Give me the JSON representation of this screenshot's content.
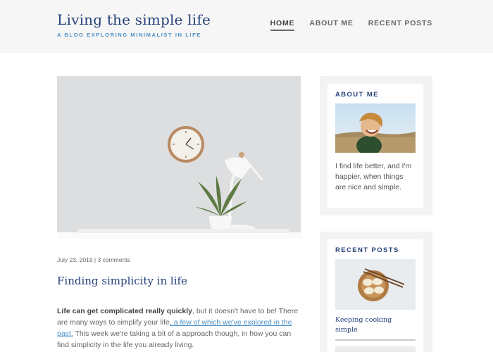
{
  "header": {
    "site_title": "Living the simple life",
    "tagline": "A BLOG EXPLORING MINIMALIST IN LIFE",
    "nav": [
      {
        "label": "HOME",
        "active": true
      },
      {
        "label": "ABOUT ME",
        "active": false
      },
      {
        "label": "RECENT POSTS",
        "active": false
      }
    ]
  },
  "post": {
    "meta": "July 23, 2019 | 3 comments",
    "title": "Finding simplicity in life",
    "excerpt_bold": "Life can get complicated really quickly",
    "excerpt_part1": ", but it doesn't have to be! There are many ways to simplify your life",
    "excerpt_link": ", a few of which we've explored in the past.",
    "excerpt_part2": " This week we're taking a bit of a approach though, in how you can find simplicity in the life you already living."
  },
  "sidebar": {
    "about": {
      "title": "ABOUT ME",
      "text": "I find life better, and I'm happier, when things are nice and simple."
    },
    "recent": {
      "title": "RECENT POSTS",
      "items": [
        {
          "label": "Keeping cooking simple"
        }
      ]
    }
  },
  "colors": {
    "accent_navy": "#25417a",
    "accent_blue": "#4a90c8",
    "header_bg": "#f6f6f6",
    "widget_bg": "#f3f3f3"
  }
}
